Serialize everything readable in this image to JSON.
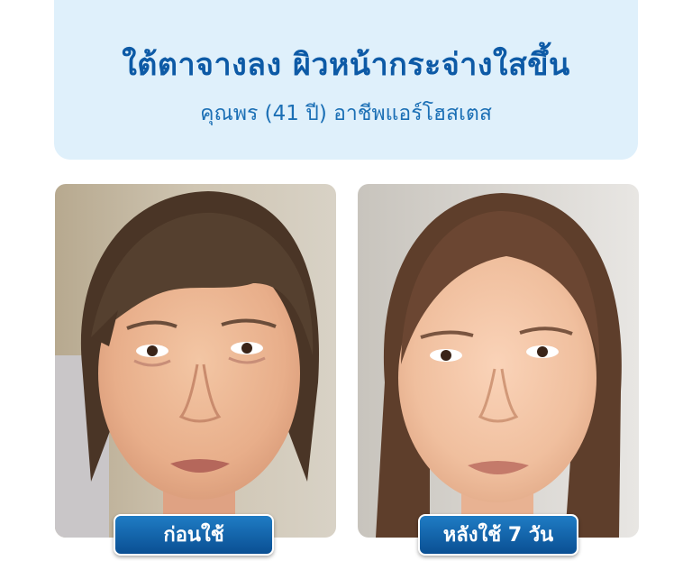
{
  "headline": {
    "title": "ใต้ตาจางลง ผิวหน้ากระจ่างใสขึ้น",
    "subtitle": "คุณพร (41 ปี) อาชีพแอร์โฮสเตส"
  },
  "photos": {
    "before_label": "ก่อนใช้",
    "after_label": "หลังใช้ 7 วัน"
  },
  "colors": {
    "headline_bg": "#dff0fb",
    "headline_text": "#0d5aa6",
    "pill_top": "#1f7cc4",
    "pill_bottom": "#0a4f93"
  }
}
